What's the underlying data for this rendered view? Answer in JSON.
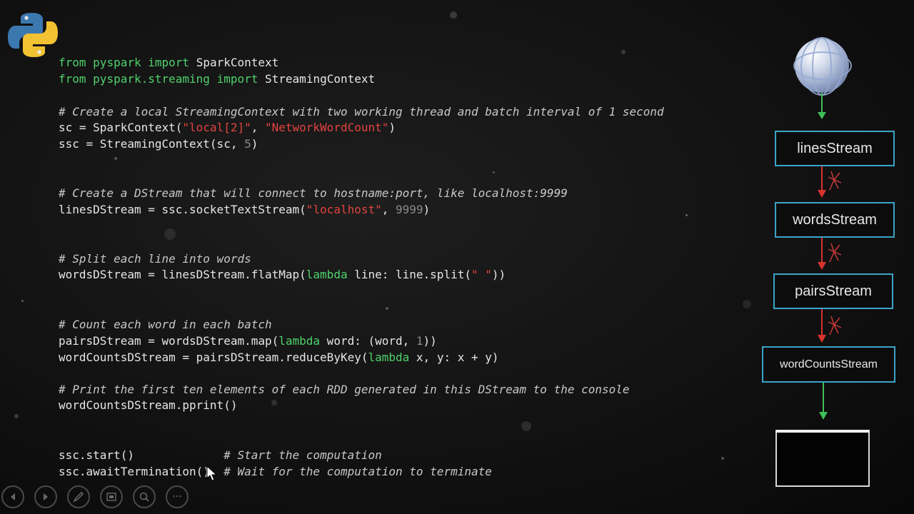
{
  "code": {
    "import1": {
      "from": "from",
      "module": "pyspark",
      "import": "import",
      "name": "SparkContext"
    },
    "import2": {
      "from": "from",
      "module": "pyspark.streaming",
      "import": "import",
      "name": "StreamingContext"
    },
    "comment1": "# Create a local StreamingContext with two working thread and batch interval of 1 second",
    "sc_line": {
      "pre": "sc = SparkContext(",
      "arg1": "\"local[2]\"",
      "sep": ", ",
      "arg2": "\"NetworkWordCount\"",
      "post": ")"
    },
    "ssc_line": {
      "pre": "ssc = StreamingContext(sc, ",
      "num": "5",
      "post": ")"
    },
    "comment2": "# Create a DStream that will connect to hostname:port, like localhost:9999",
    "lines_line": {
      "pre": "linesDStream = ssc.socketTextStream(",
      "arg1": "\"localhost\"",
      "sep": ", ",
      "num": "9999",
      "post": ")"
    },
    "comment3": "# Split each line into words",
    "words_line": {
      "pre": "wordsDStream = linesDStream.flatMap(",
      "kw": "lambda",
      "mid": " line: line.split(",
      "str": "\" \"",
      "post": "))"
    },
    "comment4": "# Count each word in each batch",
    "pairs_line": {
      "pre": "pairsDStream = wordsDStream.map(",
      "kw": "lambda",
      "mid": " word: (word, ",
      "num": "1",
      "post": "))"
    },
    "counts_line": {
      "pre": "wordCountsDStream = pairsDStream.reduceByKey(",
      "kw": "lambda",
      "post": " x, y: x + y)"
    },
    "comment5": "# Print the first ten elements of each RDD generated in this DStream to the console",
    "pprint_line": "wordCountsDStream.pprint()",
    "start_line": {
      "code": "ssc.start()             ",
      "comment": "# Start the computation"
    },
    "await_line": {
      "code": "ssc.awaitTermination()  ",
      "comment": "# Wait for the computation to terminate"
    }
  },
  "diagram": {
    "nodes": [
      "linesStream",
      "wordsStream",
      "pairsStream",
      "wordCountsStream"
    ]
  },
  "icons": {
    "logo": "python-logo",
    "source": "globe-icon",
    "sink": "console-screen-icon"
  },
  "toolbar": {
    "buttons": [
      "previous-icon",
      "next-icon",
      "pen-icon",
      "slides-icon",
      "zoom-icon",
      "more-icon"
    ],
    "more_label": "···"
  },
  "colors": {
    "keyword": "#4fd26b",
    "string": "#e2443f",
    "node_border": "#3aa3c9",
    "arrow_green": "#3fbf5a",
    "arrow_red": "#d8332d"
  }
}
